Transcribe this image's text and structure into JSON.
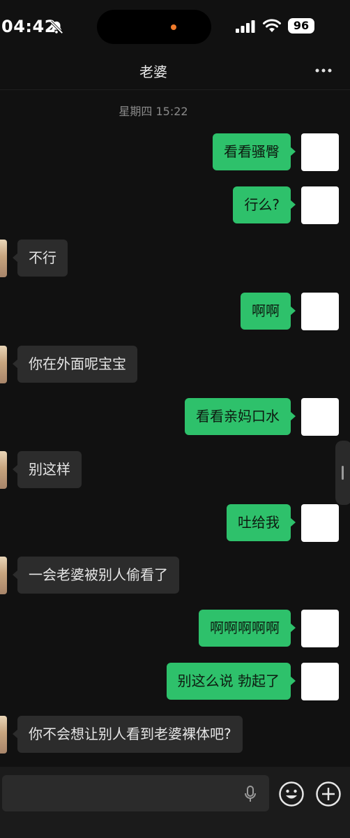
{
  "status_bar": {
    "time": "04:42",
    "battery": "96",
    "icons": [
      "bell-slash-icon",
      "cellular-signal-icon",
      "wifi-icon",
      "battery-icon"
    ]
  },
  "header": {
    "title": "老婆",
    "more_icon": "more-dots-icon"
  },
  "chat": {
    "timestamp": "星期四 15:22",
    "messages": [
      {
        "side": "sent",
        "text": "看看骚臀"
      },
      {
        "side": "sent",
        "text": "行么?"
      },
      {
        "side": "received",
        "text": "不行"
      },
      {
        "side": "sent",
        "text": "啊啊"
      },
      {
        "side": "received",
        "text": "你在外面呢宝宝"
      },
      {
        "side": "sent",
        "text": "看看亲妈口水"
      },
      {
        "side": "received",
        "text": "别这样"
      },
      {
        "side": "sent",
        "text": "吐给我"
      },
      {
        "side": "received",
        "text": "一会老婆被别人偷看了"
      },
      {
        "side": "sent",
        "text": "啊啊啊啊啊"
      },
      {
        "side": "sent",
        "text": "别这么说 勃起了"
      },
      {
        "side": "received",
        "text": "你不会想让别人看到老婆裸体吧?"
      }
    ]
  },
  "input_bar": {
    "value": "",
    "icons": [
      "microphone-icon",
      "emoji-icon",
      "plus-icon"
    ]
  },
  "colors": {
    "background": "#111111",
    "sent_bubble": "#2ec16b",
    "received_bubble": "#2c2c2c",
    "input_bar": "#1b1b1b"
  }
}
